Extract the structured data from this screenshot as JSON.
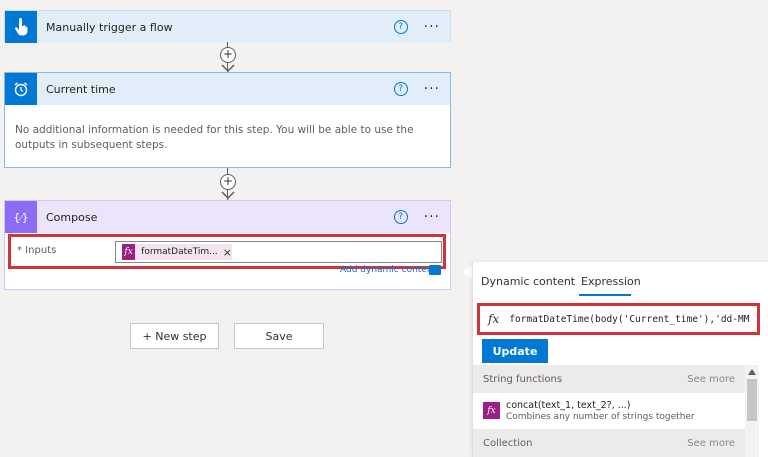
{
  "trigger": {
    "title": "Manually trigger a flow",
    "help": "?",
    "more": "···"
  },
  "current_time": {
    "title": "Current time",
    "help": "?",
    "more": "···",
    "body": "No additional information is needed for this step. You will be able to use the outputs in subsequent steps."
  },
  "compose": {
    "title": "Compose",
    "help": "?",
    "more": "···",
    "inputs_label": "* Inputs",
    "token_label": "formatDateTim...",
    "token_remove": "×",
    "add_dynamic": "Add dynamic content"
  },
  "connectors": {
    "plus": "+"
  },
  "actions": {
    "new_step": "+ New step",
    "save": "Save"
  },
  "panel": {
    "tab_dynamic": "Dynamic content",
    "tab_expression": "Expression",
    "expression_value": "formatDateTime(body('Current_time'),'dd-MM",
    "fx": "fx",
    "update_label": "Update",
    "sections": [
      {
        "title": "String functions",
        "see_more": "See more"
      },
      {
        "title": "Collection",
        "see_more": "See more"
      }
    ],
    "functions": [
      {
        "name": "concat(text_1, text_2?, ...)",
        "description": "Combines any number of strings together"
      }
    ]
  },
  "colors": {
    "trigger_accent": "#0078d4",
    "compose_accent": "#8c6cf4",
    "token_bg": "#9c1f84",
    "highlight": "#d13438",
    "update_bg": "#0078d4"
  },
  "icons": {
    "trigger": "touch-hand-icon",
    "current_time": "alarm-clock-icon",
    "compose": "compose-braces-icon",
    "token": "fx-icon"
  }
}
